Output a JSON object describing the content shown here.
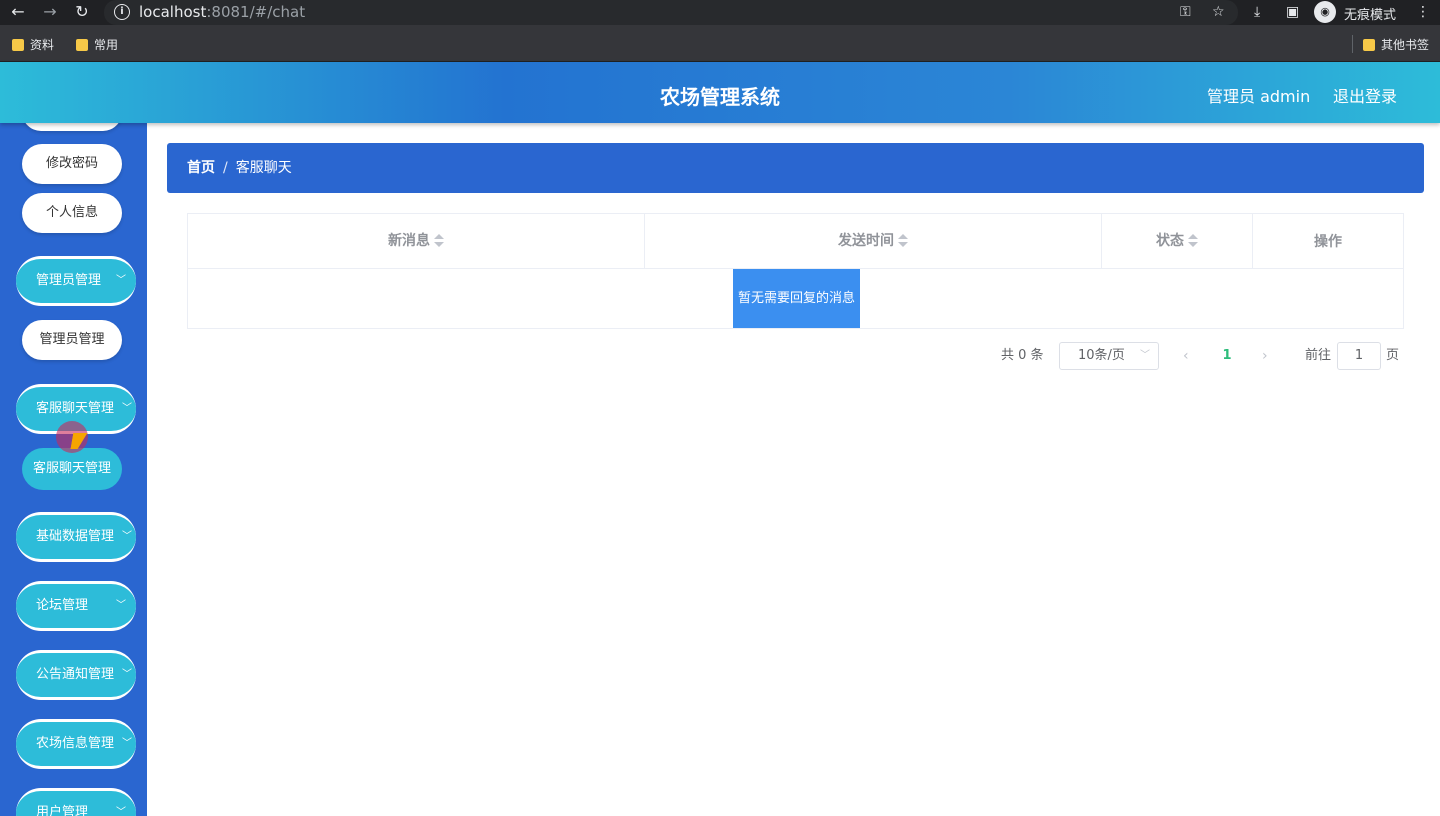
{
  "browser": {
    "url_host": "localhost",
    "url_rest": ":8081/#/chat",
    "incognito_label": "无痕模式",
    "bookmarks": [
      "资料",
      "常用"
    ],
    "other_bookmarks": "其他书签"
  },
  "header": {
    "title": "农场管理系统",
    "user": "管理员 admin",
    "logout": "退出登录"
  },
  "sidebar": {
    "change_password": "修改密码",
    "profile": "个人信息",
    "menus": {
      "admin": "管理员管理",
      "admin_sub": "管理员管理",
      "chat": "客服聊天管理",
      "chat_sub": "客服聊天管理",
      "basic": "基础数据管理",
      "forum": "论坛管理",
      "notice": "公告通知管理",
      "farm": "农场信息管理",
      "user": "用户管理"
    }
  },
  "breadcrumb": {
    "home": "首页",
    "separator": "/",
    "current": "客服聊天"
  },
  "table": {
    "columns": [
      "新消息",
      "发送时间",
      "状态",
      "操作"
    ],
    "empty_text": "暂无需要回复的消息"
  },
  "pagination": {
    "total": "共 0 条",
    "page_size": "10条/页",
    "current_page": "1",
    "goto_prefix": "前往",
    "goto_value": "1",
    "goto_suffix": "页"
  },
  "colors": {
    "sidebar": "#2a66d0",
    "accent_teal": "#2dbcd9",
    "breadcrumb": "#2a66d0",
    "active_page": "#2dbc7a"
  }
}
